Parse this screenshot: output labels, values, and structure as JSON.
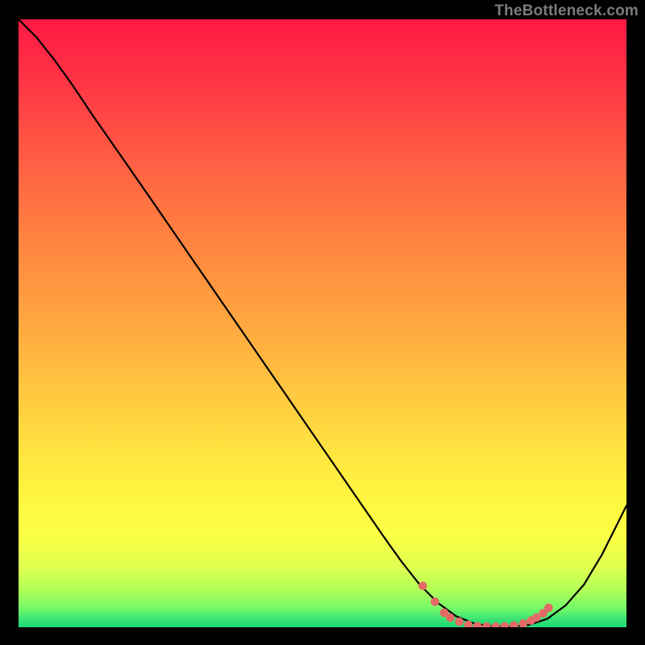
{
  "watermark": "TheBottleneck.com",
  "chart_data": {
    "type": "line",
    "title": "",
    "xlabel": "",
    "ylabel": "",
    "xlim": [
      0,
      100
    ],
    "ylim": [
      0,
      100
    ],
    "series": [
      {
        "name": "curve",
        "color": "#000000",
        "x": [
          0,
          3,
          6,
          9,
          12,
          20,
          30,
          40,
          50,
          60,
          63,
          66,
          69,
          72,
          75,
          78,
          81,
          84,
          87,
          90,
          93,
          96,
          100
        ],
        "y": [
          100,
          97,
          93.2,
          89,
          84.5,
          73,
          58.5,
          44,
          29.5,
          15,
          10.8,
          7,
          4,
          1.8,
          0.6,
          0.15,
          0.1,
          0.4,
          1.4,
          3.6,
          7,
          12,
          20
        ]
      }
    ],
    "dot_series": {
      "name": "valley-dots",
      "color": "#e46a66",
      "x": [
        66.5,
        68.5,
        70,
        71,
        72.5,
        74,
        75.5,
        77,
        78.5,
        80,
        81.5,
        83,
        84.3,
        85.2,
        86.3,
        87.2
      ],
      "y": [
        6.8,
        4.2,
        2.4,
        1.6,
        0.9,
        0.4,
        0.18,
        0.12,
        0.12,
        0.16,
        0.3,
        0.6,
        1.1,
        1.6,
        2.3,
        3.2
      ]
    }
  }
}
